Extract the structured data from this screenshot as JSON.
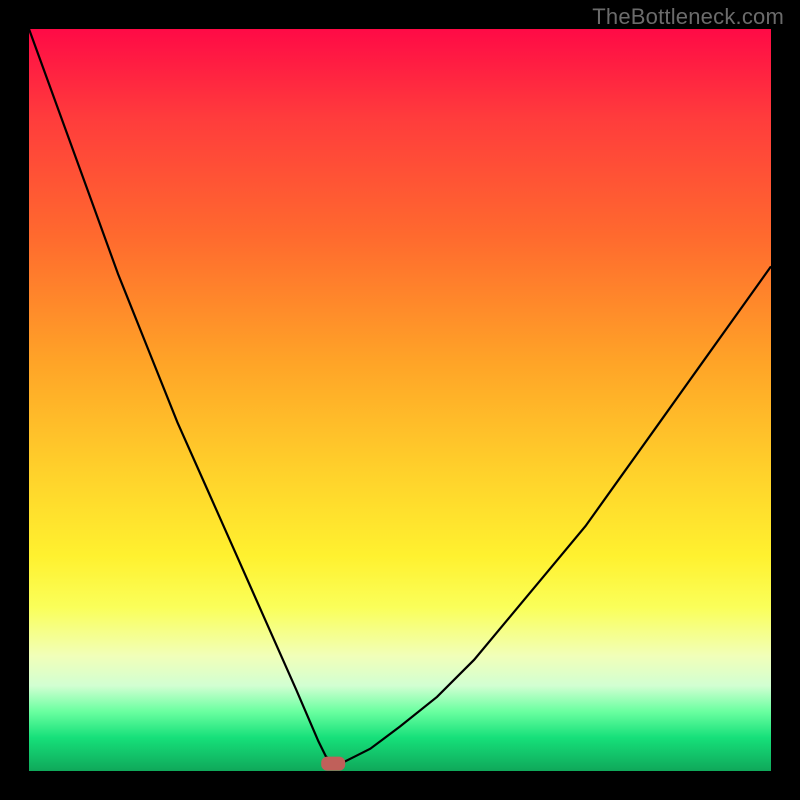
{
  "watermark": {
    "text": "TheBottleneck.com"
  },
  "chart_data": {
    "type": "line",
    "title": "",
    "xlabel": "",
    "ylabel": "",
    "xlim": [
      0,
      100
    ],
    "ylim": [
      0,
      100
    ],
    "grid": false,
    "legend": false,
    "series": [
      {
        "name": "bottleneck-curve",
        "x": [
          0,
          4,
          8,
          12,
          16,
          20,
          24,
          28,
          32,
          36,
          39,
          40,
          41,
          42,
          44,
          46,
          50,
          55,
          60,
          65,
          70,
          75,
          80,
          85,
          90,
          95,
          100
        ],
        "values": [
          100,
          89,
          78,
          67,
          57,
          47,
          38,
          29,
          20,
          11,
          4,
          2,
          1,
          1,
          2,
          3,
          6,
          10,
          15,
          21,
          27,
          33,
          40,
          47,
          54,
          61,
          68
        ],
        "color": "#000000"
      }
    ],
    "marker": {
      "name": "optimal-point",
      "x": 41,
      "y": 1,
      "color": "#c0605a"
    },
    "background_gradient": {
      "top": "#ff0a46",
      "mid": "#ffd22b",
      "bottom": "#0fa85a"
    }
  }
}
